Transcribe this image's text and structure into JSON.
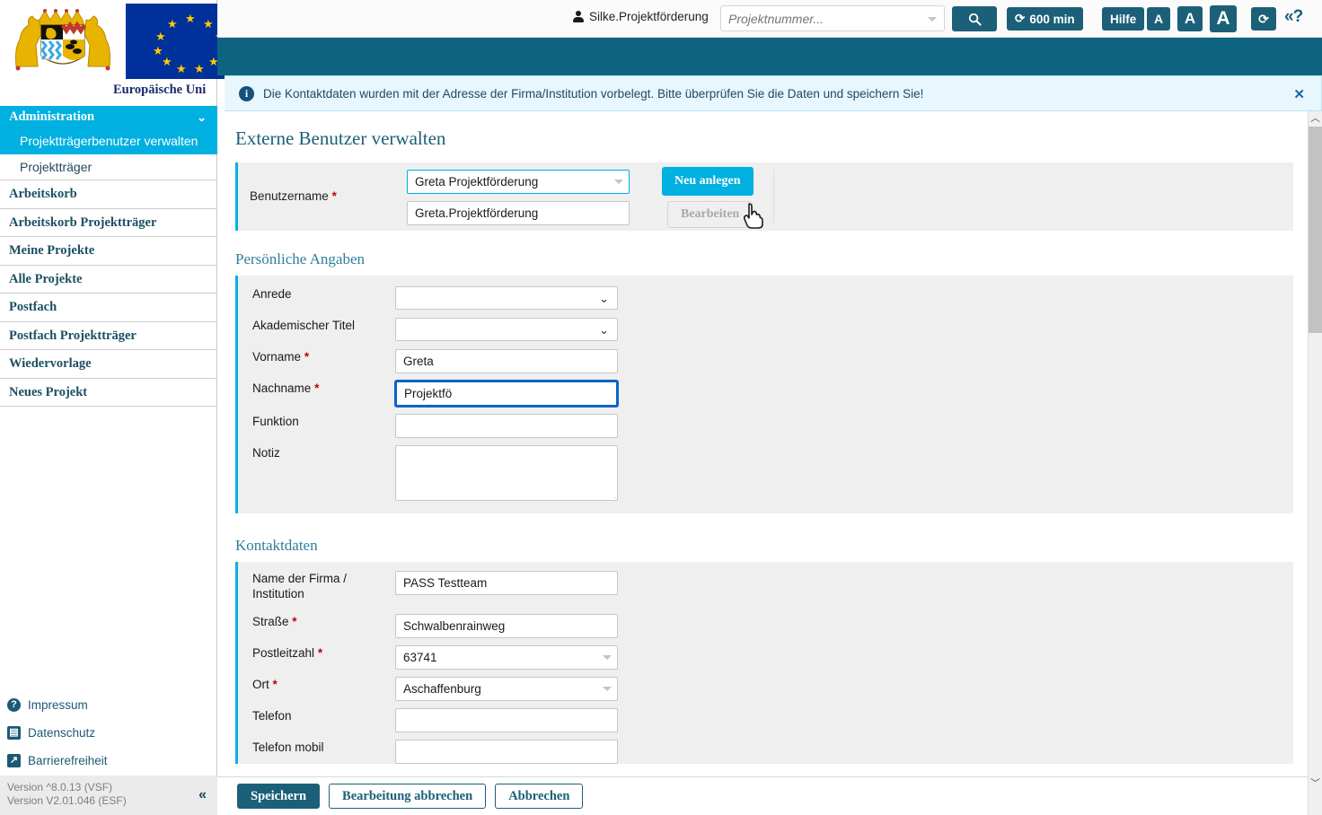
{
  "sidebar": {
    "eu_caption": "Europäische Uni",
    "nav_header": {
      "label": "Administration",
      "chevron": "chevron-down-icon"
    },
    "sub_items": [
      {
        "label": "Projektträgerbenutzer verwalten",
        "active": true
      },
      {
        "label": "Projektträger",
        "active": false
      }
    ],
    "items": [
      {
        "label": "Arbeitskorb"
      },
      {
        "label": "Arbeitskorb Projektträger"
      },
      {
        "label": "Meine Projekte"
      },
      {
        "label": "Alle Projekte"
      },
      {
        "label": "Postfach"
      },
      {
        "label": "Postfach Projektträger"
      },
      {
        "label": "Wiedervorlage"
      },
      {
        "label": "Neues Projekt"
      }
    ],
    "footer_links": [
      {
        "label": "Impressum",
        "icon": "question-mark-icon",
        "glyph": "?"
      },
      {
        "label": "Datenschutz",
        "icon": "document-icon",
        "glyph": "▤"
      },
      {
        "label": "Barrierefreiheit",
        "icon": "arrow-up-right-icon",
        "glyph": "↗"
      }
    ],
    "version_line1": "Version ^8.0.13 (VSF)",
    "version_line2": "Version V2.01.046 (ESF)",
    "collapse_glyph": "«"
  },
  "topbar": {
    "user_name": "Silke.Projektförderung",
    "search_placeholder": "Projektnummer...",
    "search_value": "",
    "search_button_icon": "search-icon",
    "session_timer": "600 min",
    "help_label": "Hilfe",
    "font_small": "A",
    "font_medium": "A",
    "font_large": "A",
    "refresh_icon": "refresh-icon",
    "collapse_glyph": "«?"
  },
  "infobar": {
    "icon": "info-icon",
    "message": "Die Kontaktdaten wurden mit der Adresse der Firma/Institution vorbelegt. Bitte überprüfen Sie die Daten und speichern Sie!",
    "close_glyph": "✕"
  },
  "main": {
    "page_title": "Externe Benutzer verwalten",
    "user_block": {
      "label": "Benutzername",
      "required": "*",
      "combo_value": "Greta Projektförderung",
      "name_value": "Greta.Projektförderung",
      "new_button": "Neu anlegen",
      "edit_button": "Bearbeiten"
    },
    "personal": {
      "title": "Persönliche Angaben",
      "fields": [
        {
          "label": "Anrede",
          "required": "",
          "type": "select",
          "value": ""
        },
        {
          "label": "Akademischer Titel",
          "required": "",
          "type": "select",
          "value": ""
        },
        {
          "label": "Vorname",
          "required": "*",
          "type": "text",
          "value": "Greta"
        },
        {
          "label": "Nachname",
          "required": "*",
          "type": "text",
          "value": "Projektfö"
        },
        {
          "label": "Funktion",
          "required": "",
          "type": "text",
          "value": ""
        },
        {
          "label": "Notiz",
          "required": "",
          "type": "textarea",
          "value": ""
        }
      ]
    },
    "contact": {
      "title": "Kontaktdaten",
      "fields": [
        {
          "label": "Name der Firma / Institution",
          "required": "",
          "type": "text",
          "value": "PASS Testteam"
        },
        {
          "label": "Straße",
          "required": "*",
          "type": "text",
          "value": "Schwalbenrainweg"
        },
        {
          "label": "Postleitzahl",
          "required": "*",
          "type": "combo",
          "value": "63741"
        },
        {
          "label": "Ort",
          "required": "*",
          "type": "combo",
          "value": "Aschaffenburg"
        },
        {
          "label": "Telefon",
          "required": "",
          "type": "text",
          "value": ""
        },
        {
          "label": "Telefon mobil",
          "required": "",
          "type": "text",
          "value": ""
        }
      ]
    }
  },
  "actionbar": {
    "save": "Speichern",
    "cancel_edit": "Bearbeitung abbrechen",
    "cancel": "Abbrechen"
  },
  "scrollbar": {
    "up_glyph": "︿",
    "down_glyph": "﹀"
  },
  "colors": {
    "teal": "#0e6480",
    "cyan": "#00b0e0",
    "panel_bg": "#efefef",
    "info_bg": "#e8f6fd",
    "required_red": "#c0000f",
    "focus_blue": "#0a64c8"
  }
}
